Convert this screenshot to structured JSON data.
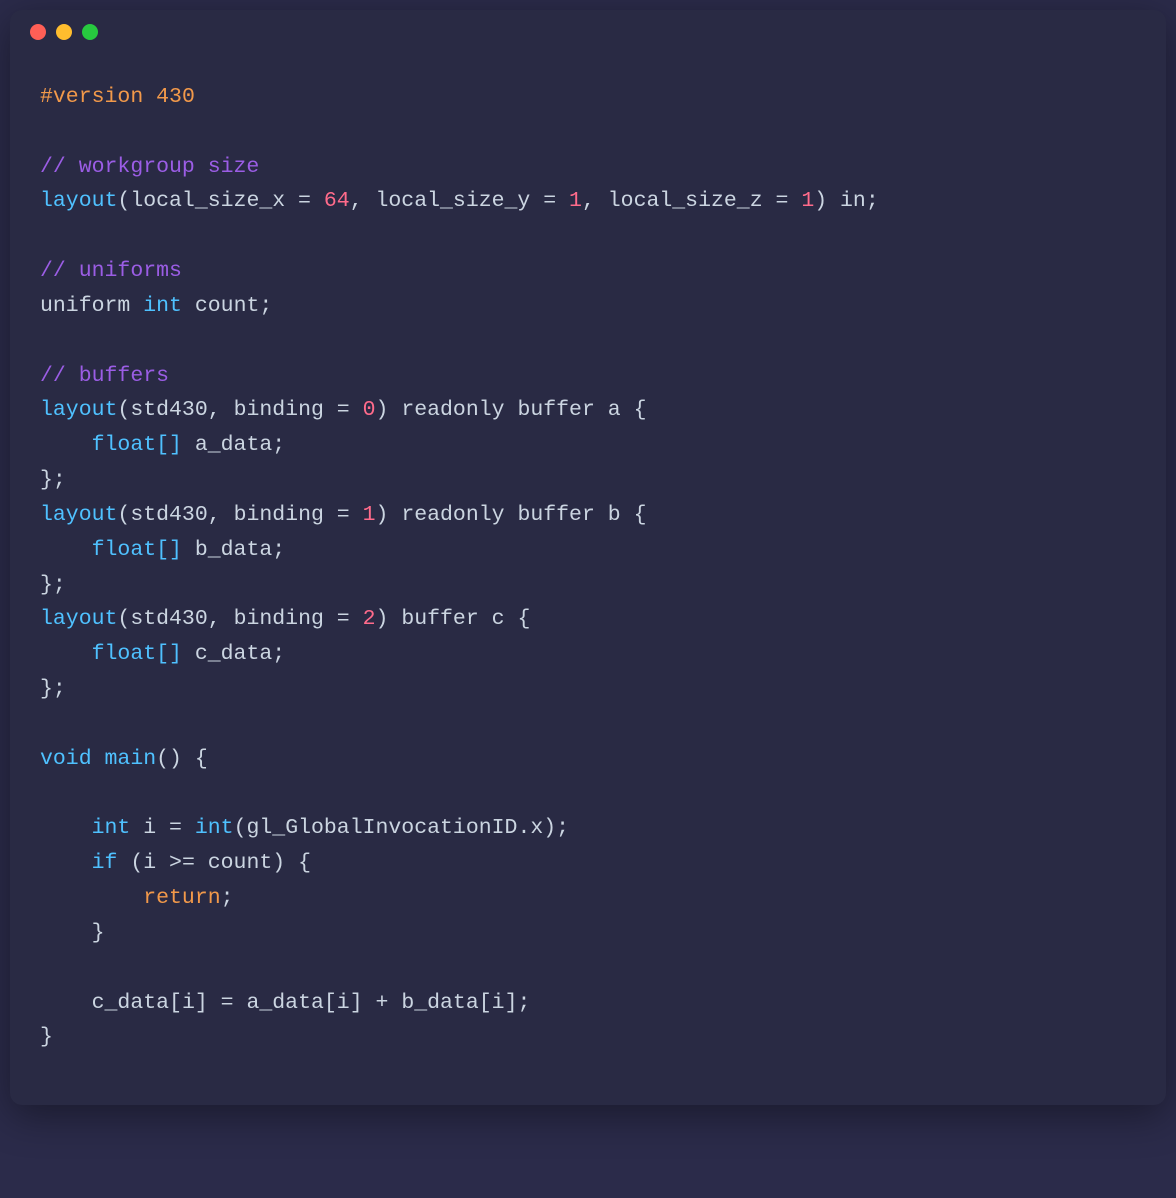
{
  "window": {
    "dots": [
      "red",
      "yellow",
      "green"
    ]
  },
  "code": {
    "directive_hash": "#",
    "directive_word": "version",
    "directive_value": "430",
    "comment_workgroup": "// workgroup size",
    "comment_uniforms": "// uniforms",
    "comment_buffers": "// buffers",
    "kw_layout": "layout",
    "kw_uniform": "uniform",
    "kw_readonly": "readonly",
    "kw_buffer": "buffer",
    "kw_void": "void",
    "kw_if": "if",
    "kw_return": "return",
    "kw_in": "in",
    "type_int": "int",
    "type_float_arr": "float[]",
    "id_local_size_x": "local_size_x",
    "id_local_size_y": "local_size_y",
    "id_local_size_z": "local_size_z",
    "id_std430": "std430",
    "id_binding": "binding",
    "id_count": "count",
    "id_a": "a",
    "id_b": "b",
    "id_c": "c",
    "id_a_data": "a_data",
    "id_b_data": "b_data",
    "id_c_data": "c_data",
    "id_main": "main",
    "id_int_cast": "int",
    "id_i": "i",
    "id_gl": "gl_GlobalInvocationID",
    "id_x": "x",
    "num_64": "64",
    "num_1a": "1",
    "num_1b": "1",
    "num_0": "0",
    "num_b1": "1",
    "num_b2": "2",
    "p_lparen": "(",
    "p_rparen": ")",
    "p_lbrace": "{",
    "p_rbrace": "}",
    "p_lbracket": "[",
    "p_rbracket": "]",
    "p_comma_sp": ", ",
    "p_eq": " = ",
    "p_semi": ";",
    "p_semi_end": ";",
    "p_dot": ".",
    "p_ge": " >= ",
    "p_plus": " + ",
    "sp": " ",
    "indent": "    ",
    "indent2": "        "
  }
}
